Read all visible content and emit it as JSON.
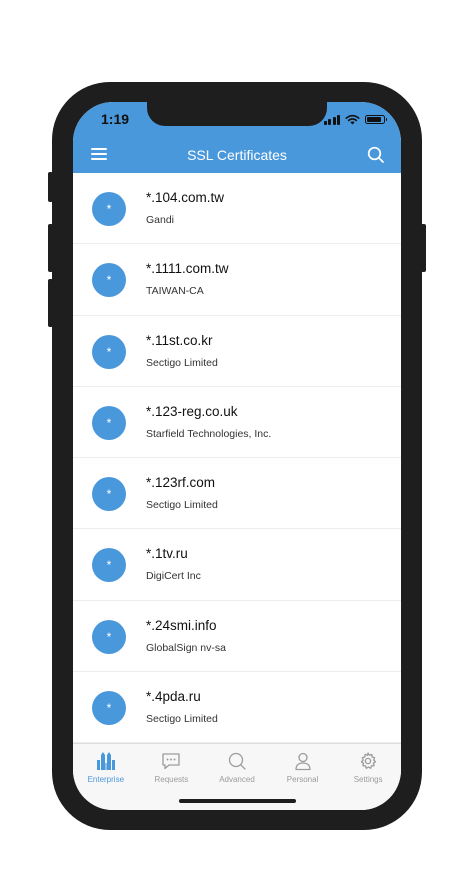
{
  "status_bar": {
    "time": "1:19"
  },
  "nav": {
    "title": "SSL Certificates"
  },
  "certificates": [
    {
      "avatar": "*",
      "domain": "*.104.com.tw",
      "issuer": "Gandi"
    },
    {
      "avatar": "*",
      "domain": "*.1111.com.tw",
      "issuer": "TAIWAN-CA"
    },
    {
      "avatar": "*",
      "domain": "*.11st.co.kr",
      "issuer": "Sectigo Limited"
    },
    {
      "avatar": "*",
      "domain": "*.123-reg.co.uk",
      "issuer": "Starfield Technologies, Inc."
    },
    {
      "avatar": "*",
      "domain": "*.123rf.com",
      "issuer": "Sectigo Limited"
    },
    {
      "avatar": "*",
      "domain": "*.1tv.ru",
      "issuer": "DigiCert Inc"
    },
    {
      "avatar": "*",
      "domain": "*.24smi.info",
      "issuer": "GlobalSign nv-sa"
    },
    {
      "avatar": "*",
      "domain": "*.4pda.ru",
      "issuer": "Sectigo Limited"
    }
  ],
  "tabs": [
    {
      "label": "Enterprise",
      "icon": "enterprise-icon",
      "active": true
    },
    {
      "label": "Requests",
      "icon": "chat-bubble-icon",
      "active": false
    },
    {
      "label": "Advanced",
      "icon": "search-icon",
      "active": false
    },
    {
      "label": "Personal",
      "icon": "person-icon",
      "active": false
    },
    {
      "label": "Settings",
      "icon": "gear-icon",
      "active": false
    }
  ],
  "colors": {
    "accent": "#4a98dc",
    "tab_inactive": "#9b9b9b",
    "frame": "#1e1e1f"
  }
}
